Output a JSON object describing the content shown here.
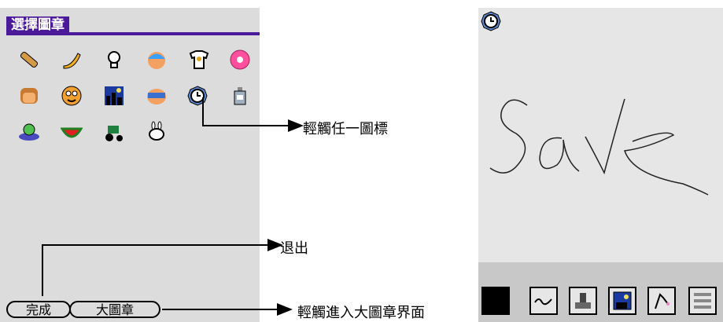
{
  "left_screen": {
    "title": "選擇圖章",
    "buttons": {
      "done": "完成",
      "big_stamp": "大圖章"
    },
    "stamps": [
      [
        "bandage-icon",
        "banana-icon",
        "bulb-icon",
        "face-blue-icon",
        "tshirt-icon",
        "donut-icon"
      ],
      [
        "girl-face-icon",
        "smiley-icon",
        "city-night-icon",
        "goggles-icon",
        "clock-icon",
        "bottle-icon"
      ],
      [
        "alien-icon",
        "watermelon-icon",
        "tractor-icon",
        "bunny-icon"
      ]
    ]
  },
  "annotations": {
    "tap_icon": "輕觸任一圖標",
    "exit": "退出",
    "enter_big": "輕觸進入大圖章界面"
  },
  "right_screen": {
    "handwriting": "Save",
    "stamp": "clock-icon",
    "tools": [
      "color-black",
      "line-tool-icon",
      "stamp-tool-icon",
      "picture-tool-icon",
      "pen-tool-icon",
      "grid-tool-icon"
    ]
  },
  "colors": {
    "title_bar": "#4a1a9a",
    "screen_bg": "#dcdcdc"
  }
}
